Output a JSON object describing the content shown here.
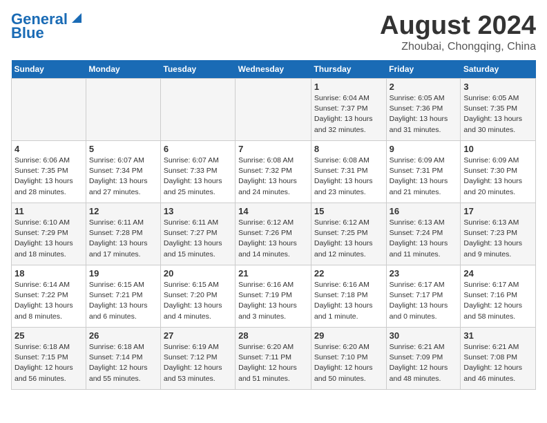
{
  "header": {
    "logo_line1": "General",
    "logo_line2": "Blue",
    "month": "August 2024",
    "location": "Zhoubai, Chongqing, China"
  },
  "weekdays": [
    "Sunday",
    "Monday",
    "Tuesday",
    "Wednesday",
    "Thursday",
    "Friday",
    "Saturday"
  ],
  "weeks": [
    [
      {
        "day": "",
        "info": ""
      },
      {
        "day": "",
        "info": ""
      },
      {
        "day": "",
        "info": ""
      },
      {
        "day": "",
        "info": ""
      },
      {
        "day": "1",
        "info": "Sunrise: 6:04 AM\nSunset: 7:37 PM\nDaylight: 13 hours\nand 32 minutes."
      },
      {
        "day": "2",
        "info": "Sunrise: 6:05 AM\nSunset: 7:36 PM\nDaylight: 13 hours\nand 31 minutes."
      },
      {
        "day": "3",
        "info": "Sunrise: 6:05 AM\nSunset: 7:35 PM\nDaylight: 13 hours\nand 30 minutes."
      }
    ],
    [
      {
        "day": "4",
        "info": "Sunrise: 6:06 AM\nSunset: 7:35 PM\nDaylight: 13 hours\nand 28 minutes."
      },
      {
        "day": "5",
        "info": "Sunrise: 6:07 AM\nSunset: 7:34 PM\nDaylight: 13 hours\nand 27 minutes."
      },
      {
        "day": "6",
        "info": "Sunrise: 6:07 AM\nSunset: 7:33 PM\nDaylight: 13 hours\nand 25 minutes."
      },
      {
        "day": "7",
        "info": "Sunrise: 6:08 AM\nSunset: 7:32 PM\nDaylight: 13 hours\nand 24 minutes."
      },
      {
        "day": "8",
        "info": "Sunrise: 6:08 AM\nSunset: 7:31 PM\nDaylight: 13 hours\nand 23 minutes."
      },
      {
        "day": "9",
        "info": "Sunrise: 6:09 AM\nSunset: 7:31 PM\nDaylight: 13 hours\nand 21 minutes."
      },
      {
        "day": "10",
        "info": "Sunrise: 6:09 AM\nSunset: 7:30 PM\nDaylight: 13 hours\nand 20 minutes."
      }
    ],
    [
      {
        "day": "11",
        "info": "Sunrise: 6:10 AM\nSunset: 7:29 PM\nDaylight: 13 hours\nand 18 minutes."
      },
      {
        "day": "12",
        "info": "Sunrise: 6:11 AM\nSunset: 7:28 PM\nDaylight: 13 hours\nand 17 minutes."
      },
      {
        "day": "13",
        "info": "Sunrise: 6:11 AM\nSunset: 7:27 PM\nDaylight: 13 hours\nand 15 minutes."
      },
      {
        "day": "14",
        "info": "Sunrise: 6:12 AM\nSunset: 7:26 PM\nDaylight: 13 hours\nand 14 minutes."
      },
      {
        "day": "15",
        "info": "Sunrise: 6:12 AM\nSunset: 7:25 PM\nDaylight: 13 hours\nand 12 minutes."
      },
      {
        "day": "16",
        "info": "Sunrise: 6:13 AM\nSunset: 7:24 PM\nDaylight: 13 hours\nand 11 minutes."
      },
      {
        "day": "17",
        "info": "Sunrise: 6:13 AM\nSunset: 7:23 PM\nDaylight: 13 hours\nand 9 minutes."
      }
    ],
    [
      {
        "day": "18",
        "info": "Sunrise: 6:14 AM\nSunset: 7:22 PM\nDaylight: 13 hours\nand 8 minutes."
      },
      {
        "day": "19",
        "info": "Sunrise: 6:15 AM\nSunset: 7:21 PM\nDaylight: 13 hours\nand 6 minutes."
      },
      {
        "day": "20",
        "info": "Sunrise: 6:15 AM\nSunset: 7:20 PM\nDaylight: 13 hours\nand 4 minutes."
      },
      {
        "day": "21",
        "info": "Sunrise: 6:16 AM\nSunset: 7:19 PM\nDaylight: 13 hours\nand 3 minutes."
      },
      {
        "day": "22",
        "info": "Sunrise: 6:16 AM\nSunset: 7:18 PM\nDaylight: 13 hours\nand 1 minute."
      },
      {
        "day": "23",
        "info": "Sunrise: 6:17 AM\nSunset: 7:17 PM\nDaylight: 13 hours\nand 0 minutes."
      },
      {
        "day": "24",
        "info": "Sunrise: 6:17 AM\nSunset: 7:16 PM\nDaylight: 12 hours\nand 58 minutes."
      }
    ],
    [
      {
        "day": "25",
        "info": "Sunrise: 6:18 AM\nSunset: 7:15 PM\nDaylight: 12 hours\nand 56 minutes."
      },
      {
        "day": "26",
        "info": "Sunrise: 6:18 AM\nSunset: 7:14 PM\nDaylight: 12 hours\nand 55 minutes."
      },
      {
        "day": "27",
        "info": "Sunrise: 6:19 AM\nSunset: 7:12 PM\nDaylight: 12 hours\nand 53 minutes."
      },
      {
        "day": "28",
        "info": "Sunrise: 6:20 AM\nSunset: 7:11 PM\nDaylight: 12 hours\nand 51 minutes."
      },
      {
        "day": "29",
        "info": "Sunrise: 6:20 AM\nSunset: 7:10 PM\nDaylight: 12 hours\nand 50 minutes."
      },
      {
        "day": "30",
        "info": "Sunrise: 6:21 AM\nSunset: 7:09 PM\nDaylight: 12 hours\nand 48 minutes."
      },
      {
        "day": "31",
        "info": "Sunrise: 6:21 AM\nSunset: 7:08 PM\nDaylight: 12 hours\nand 46 minutes."
      }
    ]
  ]
}
